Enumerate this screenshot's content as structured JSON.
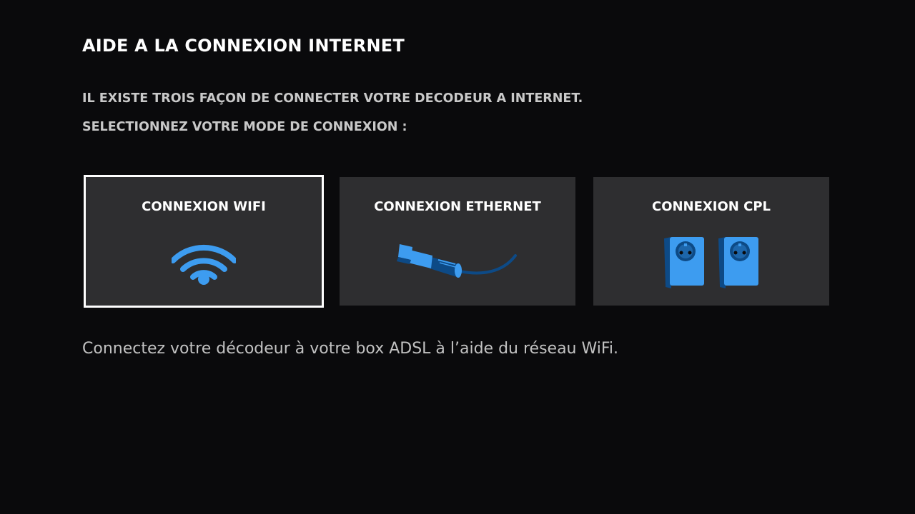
{
  "header": {
    "title": "AIDE A LA CONNEXION INTERNET",
    "line1": "IL EXISTE TROIS FAÇON DE CONNECTER VOTRE DECODEUR A INTERNET.",
    "line2": "SELECTIONNEZ VOTRE MODE DE CONNEXION :"
  },
  "options": [
    {
      "label": "CONNEXION WIFI",
      "icon": "wifi-icon",
      "selected": true
    },
    {
      "label": "CONNEXION ETHERNET",
      "icon": "ethernet-cable-icon",
      "selected": false
    },
    {
      "label": "CONNEXION CPL",
      "icon": "powerline-adapter-icon",
      "selected": false
    }
  ],
  "description": "Connectez votre décodeur à votre box ADSL à l’aide du réseau WiFi.",
  "colors": {
    "background": "#0a0a0c",
    "card": "#2e2e30",
    "accent": "#3d9cf0",
    "accent_dark": "#0d4a86",
    "selection_border": "#ffffff"
  }
}
